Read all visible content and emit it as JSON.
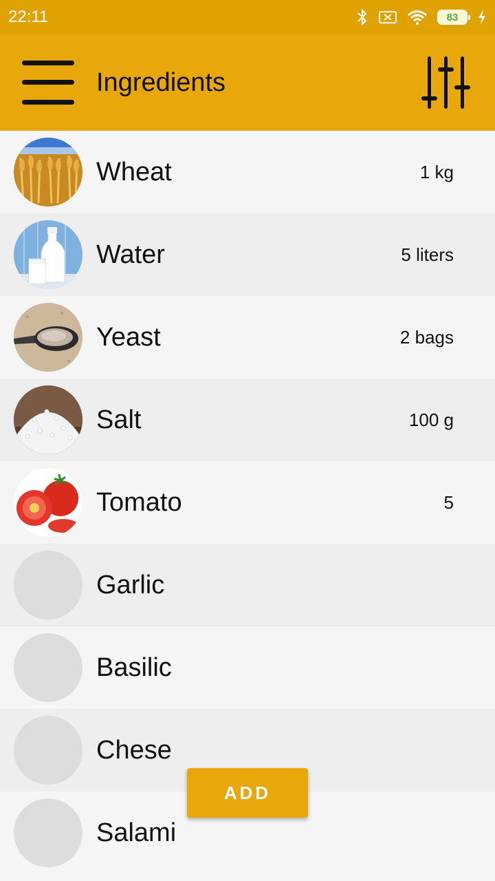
{
  "status_bar": {
    "time": "22:11",
    "battery": "83",
    "icons": [
      "bluetooth-icon",
      "sim-off-icon",
      "wifi-icon",
      "battery-icon",
      "charging-icon"
    ]
  },
  "app_bar": {
    "title": "Ingredients",
    "background": "#e8a80c",
    "menu_icon": "hamburger-menu-icon",
    "filter_icon": "sliders-icon"
  },
  "ingredients": [
    {
      "name": "Wheat",
      "qty": "1 kg",
      "image": "wheat-photo"
    },
    {
      "name": "Water",
      "qty": "5 liters",
      "image": "milk-bottle-photo"
    },
    {
      "name": "Yeast",
      "qty": "2 bags",
      "image": "yeast-spoon-photo"
    },
    {
      "name": "Salt",
      "qty": "100 g",
      "image": "salt-photo"
    },
    {
      "name": "Tomato",
      "qty": "5",
      "image": "tomato-photo"
    },
    {
      "name": "Garlic",
      "qty": "",
      "image": "placeholder"
    },
    {
      "name": "Basilic",
      "qty": "",
      "image": "placeholder"
    },
    {
      "name": "Chese",
      "qty": "",
      "image": "placeholder"
    },
    {
      "name": "Salami",
      "qty": "",
      "image": "placeholder"
    }
  ],
  "add_button": {
    "label": "ADD",
    "background": "#e8a80c"
  }
}
